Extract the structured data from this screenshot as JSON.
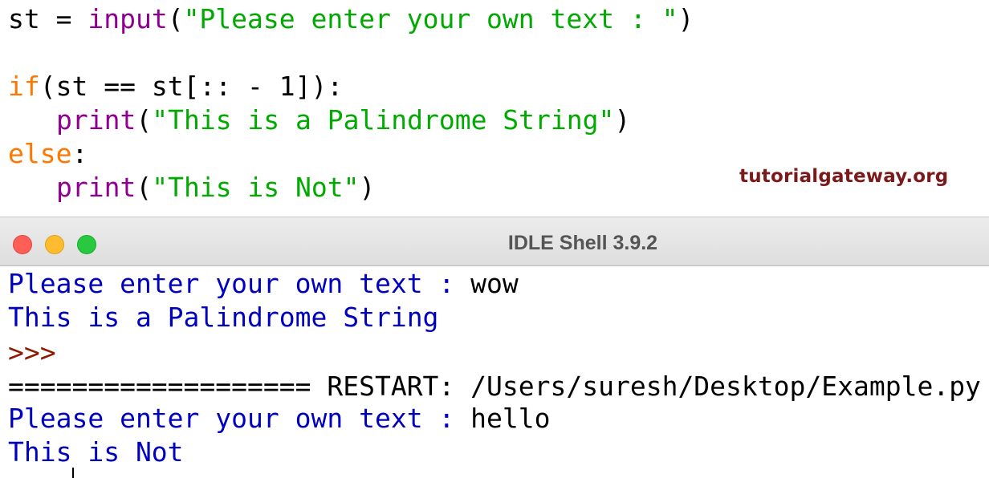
{
  "editor": {
    "lines": [
      {
        "tokens": [
          {
            "text": "st = ",
            "kind": "plain"
          },
          {
            "text": "input",
            "kind": "builtin"
          },
          {
            "text": "(",
            "kind": "plain"
          },
          {
            "text": "\"Please enter your own text : \"",
            "kind": "string"
          },
          {
            "text": ")",
            "kind": "plain"
          }
        ]
      },
      {
        "tokens": [
          {
            "text": "if",
            "kind": "keyword"
          },
          {
            "text": "(st == st[:: - 1]):",
            "kind": "plain"
          }
        ]
      },
      {
        "tokens": [
          {
            "text": "print",
            "kind": "builtin"
          },
          {
            "text": "(",
            "kind": "plain"
          },
          {
            "text": "\"This is a Palindrome String\"",
            "kind": "string"
          },
          {
            "text": ")",
            "kind": "plain"
          }
        ]
      },
      {
        "tokens": [
          {
            "text": "else",
            "kind": "keyword"
          },
          {
            "text": ":",
            "kind": "plain"
          }
        ]
      },
      {
        "tokens": [
          {
            "text": "print",
            "kind": "builtin"
          },
          {
            "text": "(",
            "kind": "plain"
          },
          {
            "text": "\"This is Not\"",
            "kind": "string"
          },
          {
            "text": ")",
            "kind": "plain"
          }
        ]
      }
    ]
  },
  "watermark": "tutorialgateway.org",
  "shell": {
    "title": "IDLE Shell 3.9.2",
    "lines": [
      {
        "prompt_text": "Please enter your own text : ",
        "input_text": "wow"
      },
      {
        "text": "This is a Palindrome String"
      },
      {
        "text": ">>>"
      },
      {
        "text": "=================== RESTART: /Users/suresh/Desktop/Example.py"
      },
      {
        "prompt_text": "Please enter your own text : ",
        "input_text": "hello"
      },
      {
        "text": "This is Not"
      }
    ]
  },
  "colors": {
    "builtin": "#900090",
    "string": "#00aa00",
    "keyword": "#ff7700",
    "stdout": "#0000c0",
    "prompt": "#8b1a00",
    "watermark": "#7a1a1a"
  }
}
